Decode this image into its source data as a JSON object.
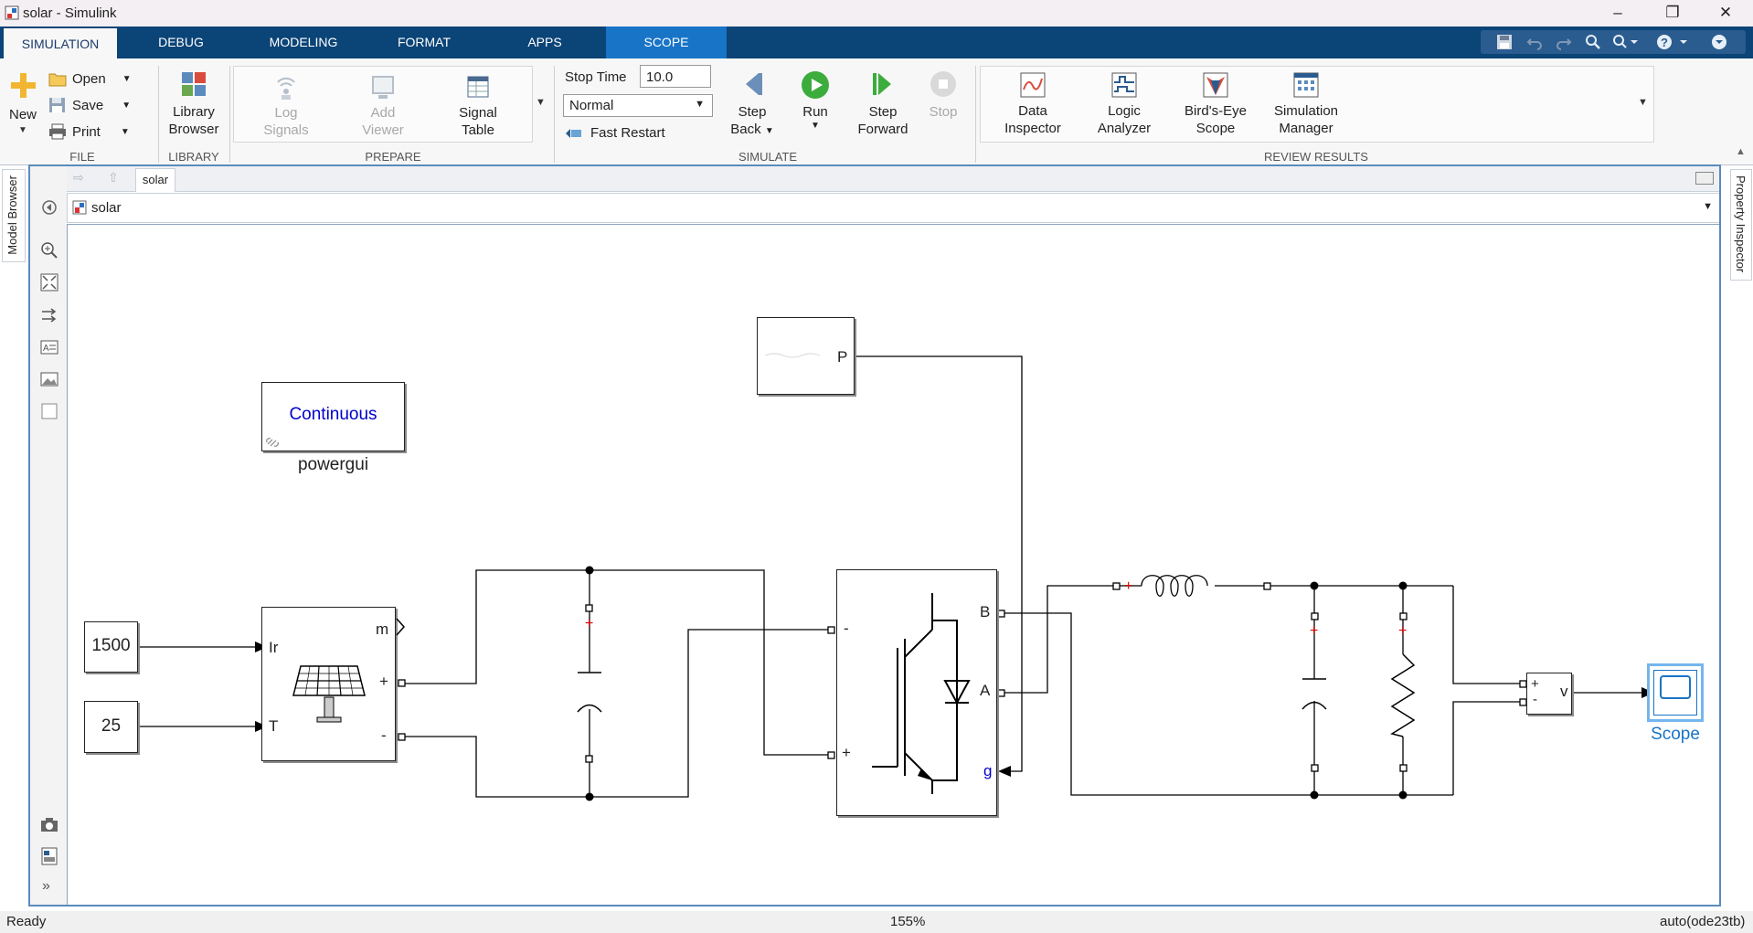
{
  "window": {
    "title": "solar - Simulink"
  },
  "tabs": [
    {
      "label": "SIMULATION"
    },
    {
      "label": "DEBUG"
    },
    {
      "label": "MODELING"
    },
    {
      "label": "FORMAT"
    },
    {
      "label": "APPS"
    },
    {
      "label": "SCOPE"
    }
  ],
  "ribbon": {
    "file": {
      "new": "New",
      "open": "Open",
      "save": "Save",
      "print": "Print",
      "group": "FILE"
    },
    "library": {
      "browser_line1": "Library",
      "browser_line2": "Browser",
      "group": "LIBRARY"
    },
    "prepare": {
      "log1": "Log",
      "log2": "Signals",
      "add1": "Add",
      "add2": "Viewer",
      "sig1": "Signal",
      "sig2": "Table",
      "group": "PREPARE"
    },
    "simulate": {
      "stop_time_label": "Stop Time",
      "stop_time_value": "10.0",
      "mode": "Normal",
      "fast_restart": "Fast Restart",
      "step_back1": "Step",
      "step_back2": "Back",
      "run": "Run",
      "step_fwd1": "Step",
      "step_fwd2": "Forward",
      "stop": "Stop",
      "group": "SIMULATE"
    },
    "review": {
      "di1": "Data",
      "di2": "Inspector",
      "la1": "Logic",
      "la2": "Analyzer",
      "be1": "Bird's-Eye",
      "be2": "Scope",
      "sm1": "Simulation",
      "sm2": "Manager",
      "group": "REVIEW RESULTS"
    }
  },
  "editor": {
    "breadcrumb_tab": "solar",
    "address": "solar",
    "left_panel": "Model Browser",
    "right_panel": "Property Inspector"
  },
  "diagram": {
    "powergui_text": "Continuous",
    "powergui_name": "powergui",
    "const_irradiance": "1500",
    "const_temperature": "25",
    "pv_ports": {
      "ir": "Ir",
      "t": "T",
      "m": "m",
      "plus": "+",
      "minus": "-"
    },
    "mppt_port": "P",
    "bridge_ports": {
      "b": "B",
      "a": "A",
      "g": "g",
      "minus": "-",
      "plus": "+"
    },
    "vm_ports": {
      "plus": "+",
      "minus": "-",
      "v": "v"
    },
    "scope_name": "Scope"
  },
  "status": {
    "left": "Ready",
    "zoom": "155%",
    "solver": "auto(ode23tb)"
  },
  "colors": {
    "tabbar": "#0b4477",
    "scope_tab": "#1874c7",
    "link_blue": "#0000cc",
    "scope_blue": "#1874c7"
  }
}
